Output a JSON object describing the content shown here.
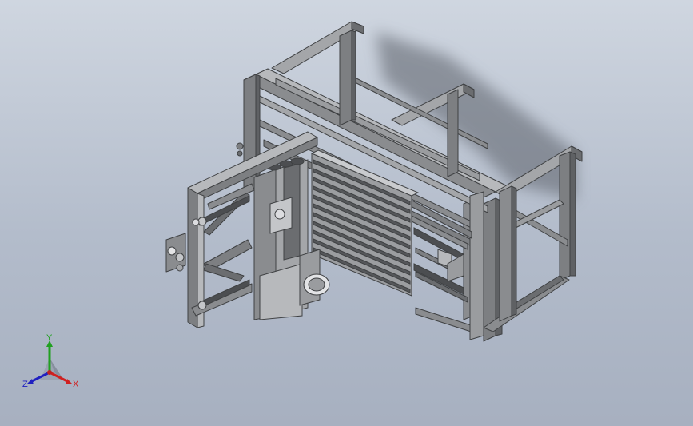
{
  "viewport": {
    "background_top": "#cfd6e0",
    "background_bottom": "#a7b0c0"
  },
  "model": {
    "frame_color": "#7d7f82",
    "frame_light": "#b7b9bc",
    "frame_dark": "#3f4143",
    "shadow_color": "#5a5f68"
  },
  "triad": {
    "x_label": "X",
    "y_label": "Y",
    "z_label": "Z",
    "x_color": "#d02020",
    "y_color": "#20a020",
    "z_color": "#2020c0"
  }
}
